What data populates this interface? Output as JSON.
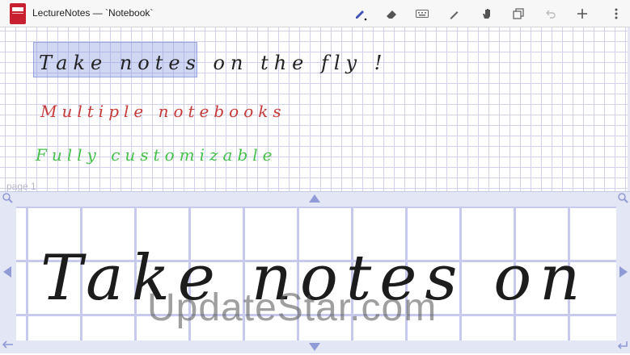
{
  "app": {
    "title": "LectureNotes — `Notebook`",
    "icon": "notebook-app-icon"
  },
  "toolbar": {
    "tools": [
      {
        "name": "pen-tool",
        "icon": "pen-icon",
        "active": true
      },
      {
        "name": "eraser-tool",
        "icon": "eraser-icon"
      },
      {
        "name": "keyboard-tool",
        "icon": "keyboard-icon"
      },
      {
        "name": "pencil-tool",
        "icon": "pencil-icon"
      },
      {
        "name": "hand-tool",
        "icon": "hand-icon"
      },
      {
        "name": "copy-tool",
        "icon": "copy-icon"
      },
      {
        "name": "undo-tool",
        "icon": "undo-icon",
        "enabled": false
      },
      {
        "name": "add-tool",
        "icon": "plus-icon"
      },
      {
        "name": "overflow-menu",
        "icon": "more-vertical-icon"
      }
    ]
  },
  "notebook": {
    "lines": [
      {
        "text": "Take notes on the fly !",
        "color": "#222222"
      },
      {
        "text": "Multiple notebooks",
        "color": "#c73a3a"
      },
      {
        "text": "Fully customizable",
        "color": "#45c04a"
      }
    ],
    "page_label": "page 1"
  },
  "zoom_panel": {
    "handwriting": "Take notes on",
    "controls": [
      "zoom-in-icon",
      "arrow-up-icon",
      "zoom-in-icon",
      "arrow-left-icon",
      "arrow-right-icon",
      "undo-icon",
      "arrow-down-icon",
      "enter-icon"
    ]
  },
  "watermark": "UpdateStar.com",
  "colors": {
    "accent": "#3f51b5",
    "grid": "#d2d2ef",
    "panel": "#e3e6f4",
    "app_red": "#c8202f"
  }
}
